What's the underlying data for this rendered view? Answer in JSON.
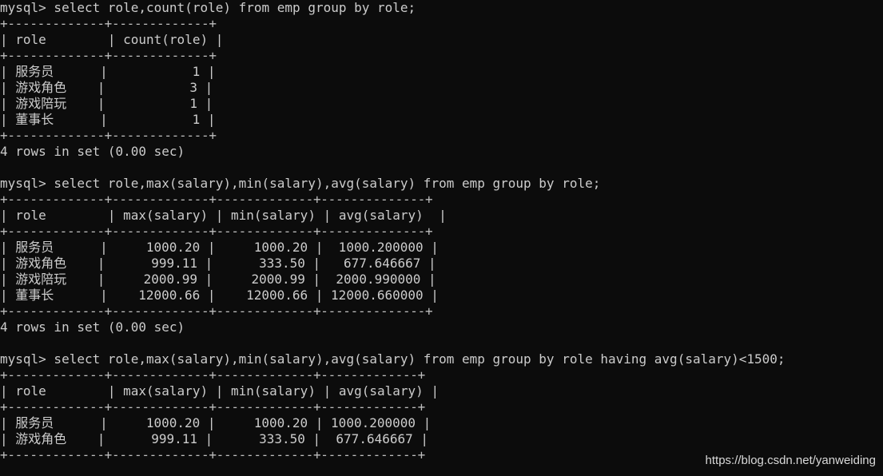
{
  "terminal": {
    "lines": [
      "mysql> select role,count(role) from emp group by role;",
      "+-------------+-------------+",
      "| role        | count(role) |",
      "+-------------+-------------+",
      "| 服务员      |           1 |",
      "| 游戏角色    |           3 |",
      "| 游戏陪玩    |           1 |",
      "| 董事长      |           1 |",
      "+-------------+-------------+",
      "4 rows in set (0.00 sec)",
      "",
      "mysql> select role,max(salary),min(salary),avg(salary) from emp group by role;",
      "+-------------+-------------+-------------+--------------+",
      "| role        | max(salary) | min(salary) | avg(salary)  |",
      "+-------------+-------------+-------------+--------------+",
      "| 服务员      |     1000.20 |     1000.20 |  1000.200000 |",
      "| 游戏角色    |      999.11 |      333.50 |   677.646667 |",
      "| 游戏陪玩    |     2000.99 |     2000.99 |  2000.990000 |",
      "| 董事长      |    12000.66 |    12000.66 | 12000.660000 |",
      "+-------------+-------------+-------------+--------------+",
      "4 rows in set (0.00 sec)",
      "",
      "mysql> select role,max(salary),min(salary),avg(salary) from emp group by role having avg(salary)<1500;",
      "+-------------+-------------+-------------+-------------+",
      "| role        | max(salary) | min(salary) | avg(salary) |",
      "+-------------+-------------+-------------+-------------+",
      "| 服务员      |     1000.20 |     1000.20 | 1000.200000 |",
      "| 游戏角色    |      999.11 |      333.50 |  677.646667 |",
      "+-------------+-------------+-------------+-------------+"
    ]
  },
  "watermark": "https://blog.csdn.net/yanweiding"
}
